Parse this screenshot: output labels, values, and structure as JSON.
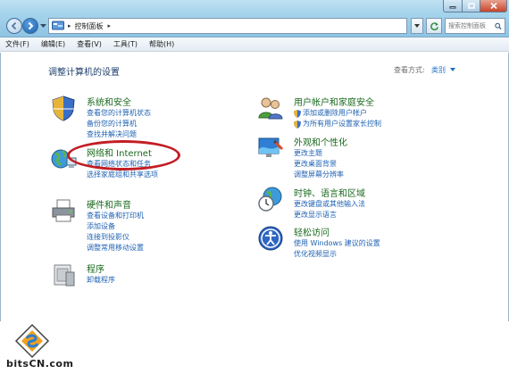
{
  "window": {
    "breadcrumb": "控制面板",
    "search_placeholder": "搜索控制面板"
  },
  "menubar": {
    "items": [
      "文件(F)",
      "编辑(E)",
      "查看(V)",
      "工具(T)",
      "帮助(H)"
    ]
  },
  "content": {
    "title": "调整计算机的设置",
    "view_by_label": "查看方式:",
    "view_by_value": "类别"
  },
  "categories": {
    "system_security": {
      "title": "系统和安全",
      "links": [
        "查看您的计算机状态",
        "备份您的计算机",
        "查找并解决问题"
      ]
    },
    "network_internet": {
      "title": "网络和 Internet",
      "links": [
        "查看网络状态和任务",
        "选择家庭组和共享选项"
      ]
    },
    "hardware_sound": {
      "title": "硬件和声音",
      "links": [
        "查看设备和打印机",
        "添加设备",
        "连接到投影仪",
        "调整常用移动设置"
      ]
    },
    "programs": {
      "title": "程序",
      "links": [
        "卸载程序"
      ]
    },
    "user_accounts": {
      "title": "用户帐户和家庭安全",
      "links": [
        "添加或删除用户帐户",
        "为所有用户设置家长控制"
      ]
    },
    "appearance": {
      "title": "外观和个性化",
      "links": [
        "更改主题",
        "更改桌面背景",
        "调整屏幕分辨率"
      ]
    },
    "clock_region": {
      "title": "时钟、语言和区域",
      "links": [
        "更改键盘或其他输入法",
        "更改显示语言"
      ]
    },
    "ease_access": {
      "title": "轻松访问",
      "links": [
        "使用 Windows 建议的设置",
        "优化视频显示"
      ]
    }
  },
  "watermark": {
    "text": "bitsCN.com"
  },
  "colors": {
    "category_title": "#1a6a1e",
    "link": "#1f62b3",
    "highlight": "#c31d24"
  }
}
